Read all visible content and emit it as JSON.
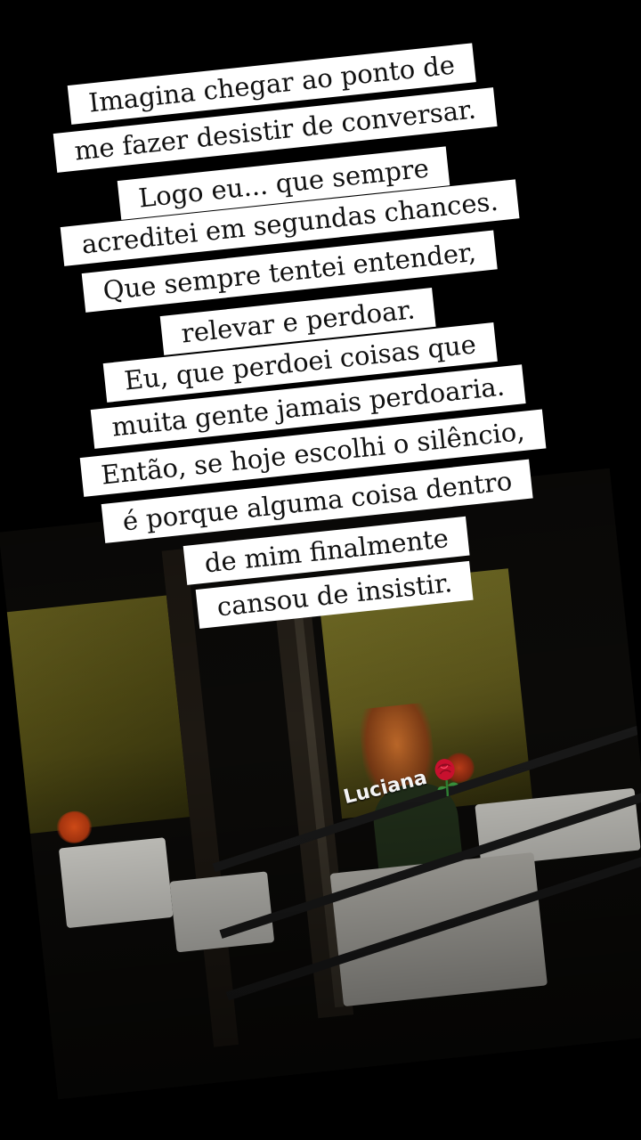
{
  "quote": {
    "lines": [
      "Imagina chegar ao ponto de",
      "me fazer desistir de conversar.",
      "Logo eu... que sempre",
      "acreditei em segundas chances.",
      "Que sempre tentei entender,",
      "relevar e perdoar.",
      "Eu, que perdoei coisas que",
      "muita gente jamais perdoaria.",
      "Então, se hoje escolhi o silêncio,",
      "é porque alguma coisa dentro",
      "de mim finalmente",
      "cansou de insistir."
    ]
  },
  "signature": {
    "name": "Luciana",
    "icon": "rose-icon"
  },
  "colors": {
    "background": "#000000",
    "strip": "#ffffff",
    "text": "#111111",
    "rose": "#c8102e"
  }
}
